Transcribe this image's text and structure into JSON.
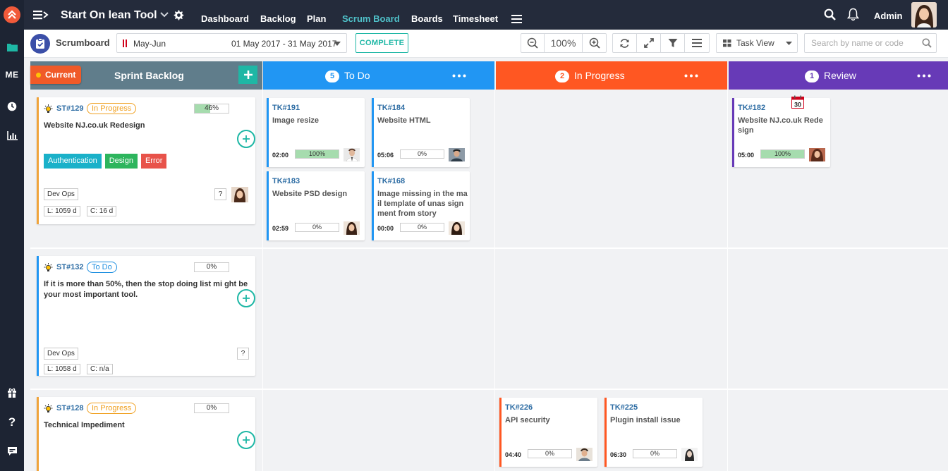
{
  "rail": {
    "me_label": "ME"
  },
  "topbar": {
    "app_title": "Start On lean Tool",
    "nav": [
      {
        "label": "Dashboard",
        "active": false
      },
      {
        "label": "Backlog",
        "active": false
      },
      {
        "label": "Plan",
        "active": false
      },
      {
        "label": "Scrum Board",
        "active": true
      },
      {
        "label": "Boards",
        "active": false
      },
      {
        "label": "Timesheet",
        "active": false
      }
    ],
    "user_name": "Admin"
  },
  "toolbar": {
    "scrumboard_label": "Scrumboard",
    "sprint_name": "May-Jun",
    "sprint_range": "01 May 2017 - 31 May 2017",
    "complete_label": "COMPLETE",
    "zoom_level": "100%",
    "view_label": "Task View",
    "search_placeholder": "Search by name or code"
  },
  "columns": {
    "backlog": {
      "current_label": "Current",
      "title": "Sprint Backlog",
      "color": "#607d8b"
    },
    "todo": {
      "title": "To Do",
      "count": "5",
      "color": "#2196f3"
    },
    "inprogress": {
      "title": "In Progress",
      "count": "2",
      "color": "#ff5722"
    },
    "review": {
      "title": "Review",
      "count": "1",
      "color": "#673ab7"
    }
  },
  "stories": [
    {
      "code": "ST#129",
      "status": "In Progress",
      "progress": 46,
      "progress_label": "46%",
      "title": "Website NJ.co.uk Redesign",
      "tags": [
        {
          "label": "Authentication",
          "color": "#1ab1c9"
        },
        {
          "label": "Design",
          "color": "#2db55d"
        },
        {
          "label": "Error",
          "color": "#e8534a"
        }
      ],
      "team": "Dev Ops",
      "q": "?",
      "lead": "L: 1059 d",
      "cycle": "C: 16 d",
      "bar_color": "#f0a43b"
    },
    {
      "code": "ST#132",
      "status": "To Do",
      "progress": 0,
      "progress_label": "0%",
      "title": "If it is more than 50%, then the stop doing list mi ght be your most important tool.",
      "team": "Dev Ops",
      "q": "?",
      "lead": "L: 1058 d",
      "cycle": "C: n/a",
      "bar_color": "#2196f3"
    },
    {
      "code": "ST#128",
      "status": "In Progress",
      "progress": 0,
      "progress_label": "0%",
      "title": "Technical Impediment",
      "bar_color": "#f0a43b"
    }
  ],
  "tasks": [
    {
      "code": "TK#191",
      "title": "Image resize",
      "time": "02:00",
      "progress": 100,
      "progress_label": "100%",
      "bar_color": "#2196f3"
    },
    {
      "code": "TK#184",
      "title": "Website HTML",
      "time": "05:06",
      "progress": 0,
      "progress_label": "0%",
      "bar_color": "#2196f3"
    },
    {
      "code": "TK#183",
      "title": "Website PSD design",
      "time": "02:59",
      "progress": 0,
      "progress_label": "0%",
      "bar_color": "#2196f3"
    },
    {
      "code": "TK#168",
      "title": "Image missing in the mail template of unas signment from story",
      "time": "00:00",
      "progress": 0,
      "progress_label": "0%",
      "bar_color": "#2196f3"
    },
    {
      "code": "TK#182",
      "title": "Website NJ.co.uk Rede sign",
      "time": "05:00",
      "progress": 100,
      "progress_label": "100%",
      "bar_color": "#673ab7",
      "calendar_day": "30"
    },
    {
      "code": "TK#226",
      "title": "API security",
      "time": "04:40",
      "progress": 0,
      "progress_label": "0%",
      "bar_color": "#ff5722"
    },
    {
      "code": "TK#225",
      "title": "Plugin install issue",
      "time": "06:30",
      "progress": 0,
      "progress_label": "0%",
      "bar_color": "#ff5722"
    }
  ]
}
